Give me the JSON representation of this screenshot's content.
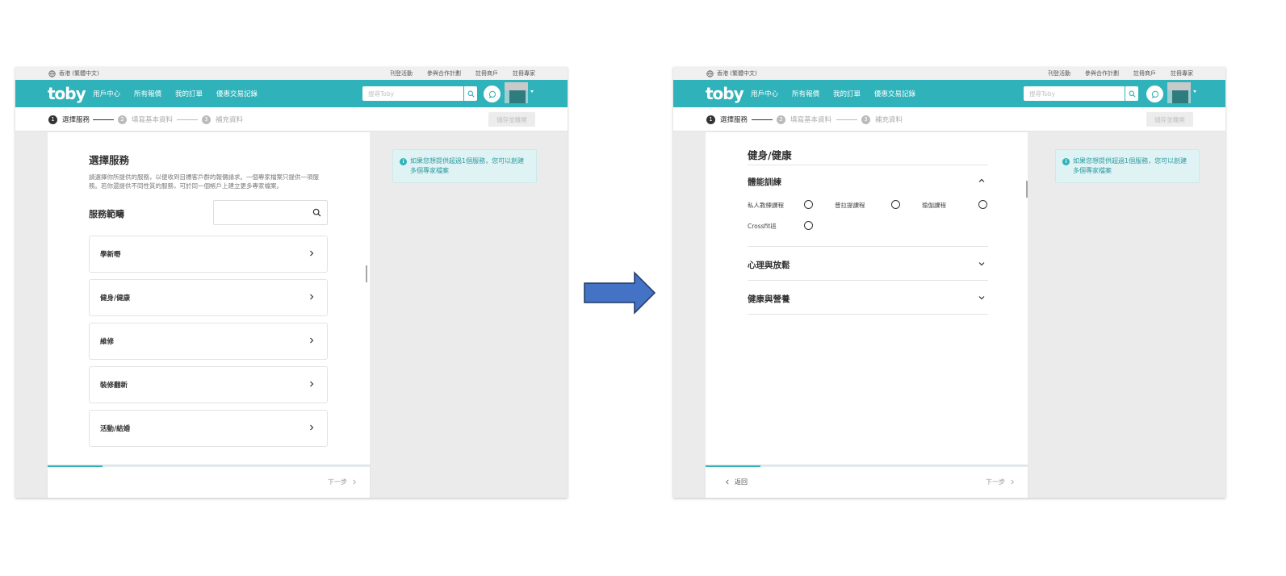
{
  "common": {
    "region": "香港 (繁體中文)",
    "top_links": [
      "刊登活動",
      "參與合作計劃",
      "註冊商戶",
      "註冊專家"
    ],
    "logo": "toby",
    "nav_items": [
      "用戶中心",
      "所有報價",
      "我的訂單",
      "優惠交易記錄"
    ],
    "search_placeholder": "搜尋Toby",
    "steps": [
      {
        "num": "1",
        "label": "選擇服務"
      },
      {
        "num": "2",
        "label": "填寫基本資料"
      },
      {
        "num": "3",
        "label": "補充資料"
      }
    ],
    "save_draft": "儲存並離開",
    "info_text": "如果您想提供超過1個服務，您可以創建多個專家檔案",
    "next": "下一步",
    "back": "返回",
    "progress_fraction": 0.17,
    "colors": {
      "brand": "#2fb2ba",
      "info_bg": "#e0f3f4",
      "arrow_fill": "#4472c4",
      "arrow_stroke": "#1f3864"
    }
  },
  "left": {
    "title": "選擇服務",
    "description": "請選擇你所提供的服務，以便收到目標客戶群的報價請求。一個專家檔案只提供一項服務。若你還提供不同性質的服務，可於同一個帳戶上建立更多專家檔案。",
    "scope_title": "服務範疇",
    "services": [
      "學新嘢",
      "健身/健康",
      "維修",
      "裝修翻新",
      "活動/結婚"
    ]
  },
  "right": {
    "section_title": "健身/健康",
    "accordions": [
      {
        "title": "體能訓練",
        "expanded": true,
        "options": [
          "私人教練課程",
          "普拉提課程",
          "瑜伽課程",
          "Crossfit班"
        ]
      },
      {
        "title": "心理與放鬆",
        "expanded": false
      },
      {
        "title": "健康與營養",
        "expanded": false
      }
    ]
  }
}
